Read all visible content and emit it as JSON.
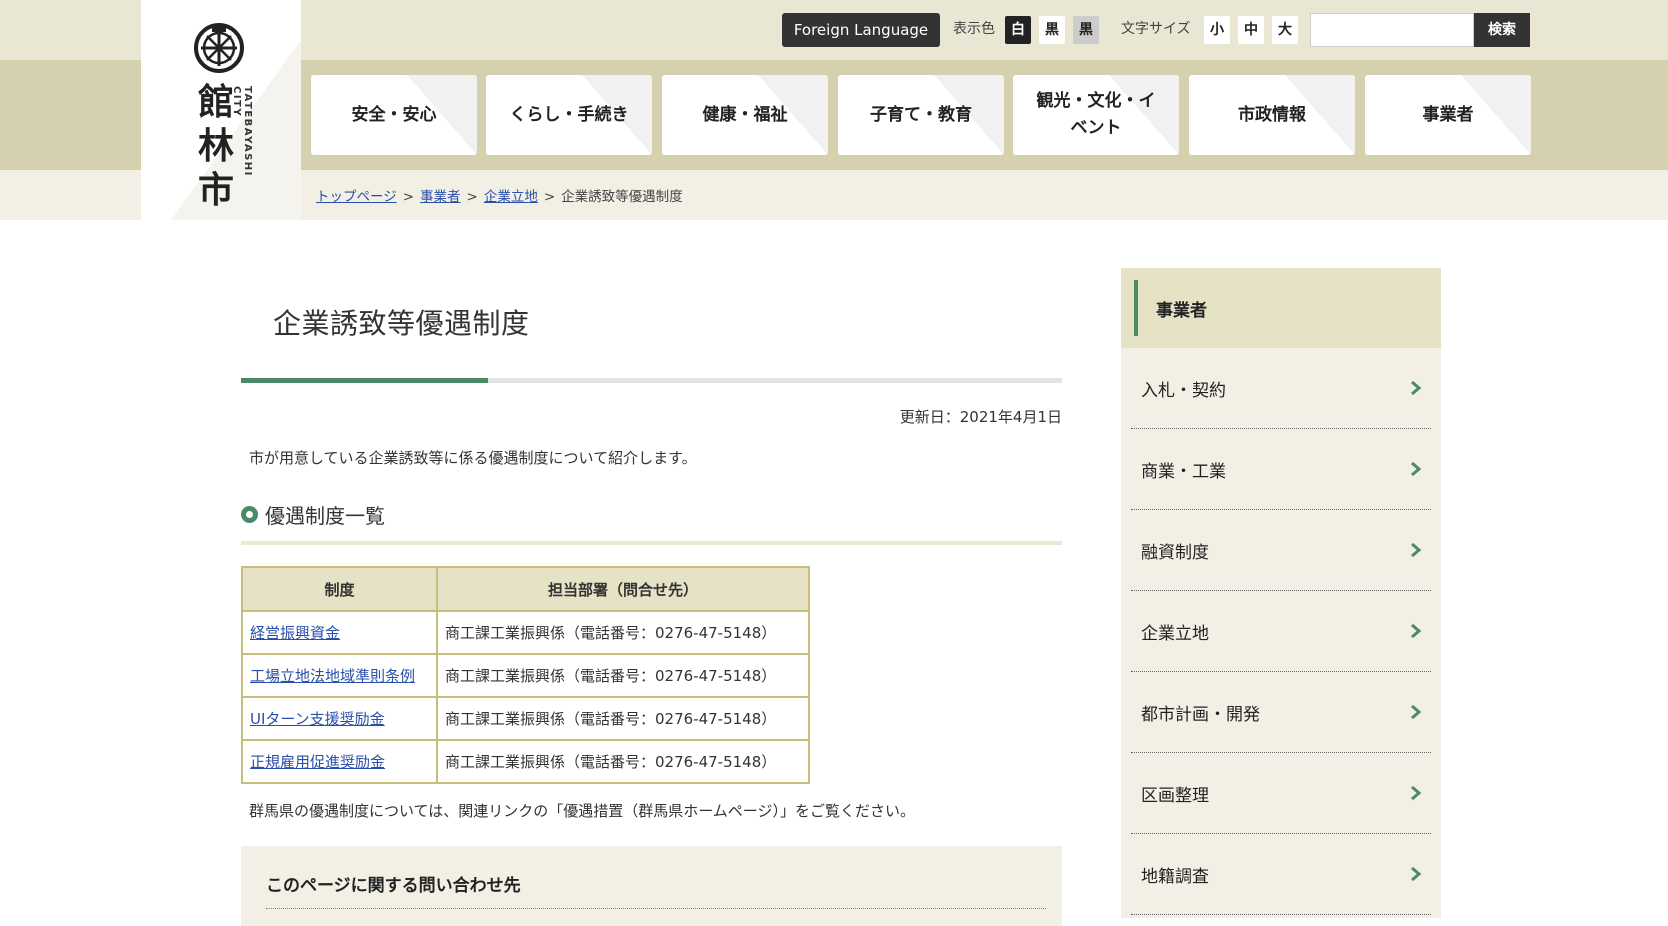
{
  "logo": {
    "kanji": [
      "館",
      "林",
      "市"
    ],
    "roman": "TATEBAYASHI CITY"
  },
  "header": {
    "foreign_language": "Foreign Language",
    "display_color_label": "表示色",
    "display_colors": [
      "白",
      "黒",
      "黒"
    ],
    "font_size_label": "文字サイズ",
    "font_sizes": [
      "小",
      "中",
      "大"
    ],
    "search_value": "",
    "search_button": "検索"
  },
  "nav": [
    "安全・安心",
    "くらし・手続き",
    "健康・福祉",
    "子育て・教育",
    "観光・文化・イベント",
    "市政情報",
    "事業者"
  ],
  "breadcrumb": {
    "items": [
      "トップページ",
      "事業者",
      "企業立地"
    ],
    "separator": ">",
    "current": "企業誘致等優遇制度"
  },
  "main": {
    "title": "企業誘致等優遇制度",
    "updated": "更新日：2021年4月1日",
    "intro": "市が用意している企業誘致等に係る優遇制度について紹介します。",
    "section_heading": "優遇制度一覧",
    "table": {
      "headers": [
        "制度",
        "担当部署（問合せ先）"
      ],
      "rows": [
        [
          "経営振興資金",
          "商工課工業振興係（電話番号：0276-47-5148）"
        ],
        [
          "工場立地法地域準則条例",
          "商工課工業振興係（電話番号：0276-47-5148）"
        ],
        [
          "UIターン支援奨励金",
          "商工課工業振興係（電話番号：0276-47-5148）"
        ],
        [
          "正規雇用促進奨励金",
          "商工課工業振興係（電話番号：0276-47-5148）"
        ]
      ]
    },
    "note": "群馬県の優遇制度については、関連リンクの「優遇措置（群馬県ホームページ）」をご覧ください。",
    "contact_title": "このページに関する問い合わせ先"
  },
  "sidebar": {
    "heading": "事業者",
    "items": [
      "入札・契約",
      "商業・工業",
      "融資制度",
      "企業立地",
      "都市計画・開発",
      "区画整理",
      "地籍調査"
    ]
  },
  "colors": {
    "accent_green": "#4a8a66",
    "header_beige": "#d5d0ae",
    "table_border": "#c8be7c",
    "link_blue": "#2a4fa8"
  }
}
